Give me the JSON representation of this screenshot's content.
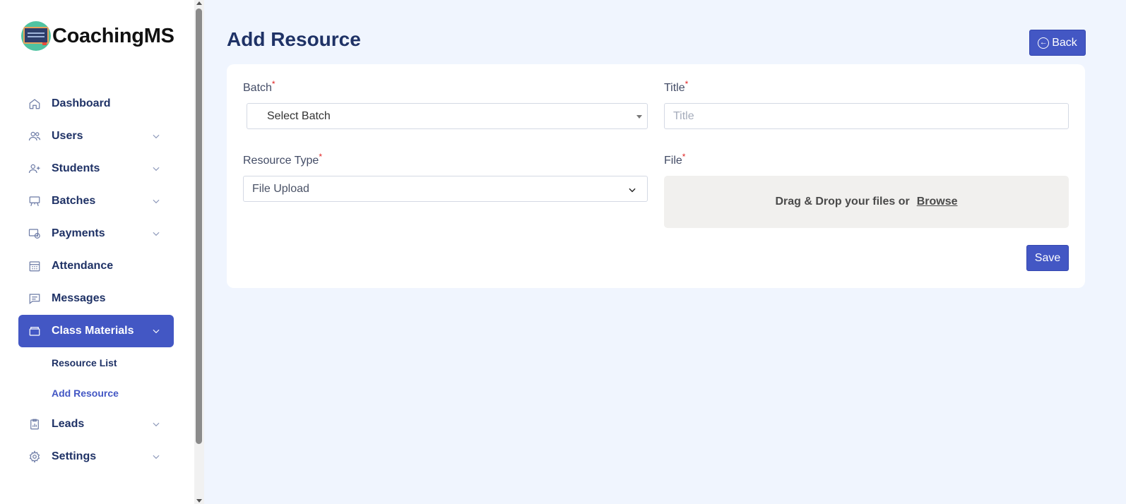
{
  "brand": {
    "name": "CoachingMS"
  },
  "sidebar": {
    "items": [
      {
        "label": "Dashboard",
        "icon": "home-icon",
        "expandable": false
      },
      {
        "label": "Users",
        "icon": "users-icon",
        "expandable": true
      },
      {
        "label": "Students",
        "icon": "user-plus-icon",
        "expandable": true
      },
      {
        "label": "Batches",
        "icon": "easel-icon",
        "expandable": true
      },
      {
        "label": "Payments",
        "icon": "payment-icon",
        "expandable": true
      },
      {
        "label": "Attendance",
        "icon": "calendar-icon",
        "expandable": false
      },
      {
        "label": "Messages",
        "icon": "message-icon",
        "expandable": false
      },
      {
        "label": "Class Materials",
        "icon": "briefcase-icon",
        "expandable": true,
        "active": true,
        "children": [
          {
            "label": "Resource List"
          },
          {
            "label": "Add Resource",
            "current": true
          }
        ]
      },
      {
        "label": "Leads",
        "icon": "clipboard-icon",
        "expandable": true
      },
      {
        "label": "Settings",
        "icon": "gear-icon",
        "expandable": true
      }
    ]
  },
  "header": {
    "title": "Add Resource",
    "back_label": "Back"
  },
  "form": {
    "batch": {
      "label": "Batch",
      "required_mark": "*",
      "value": "Select Batch"
    },
    "title": {
      "label": "Title",
      "required_mark": "*",
      "placeholder": "Title",
      "value": ""
    },
    "resource_type": {
      "label": "Resource Type",
      "required_mark": "*",
      "value": "File Upload"
    },
    "file": {
      "label": "File",
      "required_mark": "*",
      "drop_text": "Drag & Drop your files or",
      "browse_label": "Browse"
    },
    "save_label": "Save"
  },
  "colors": {
    "accent": "#4357c4",
    "background": "#f0f5fe",
    "required": "#e02424",
    "heading": "#1f3266"
  }
}
